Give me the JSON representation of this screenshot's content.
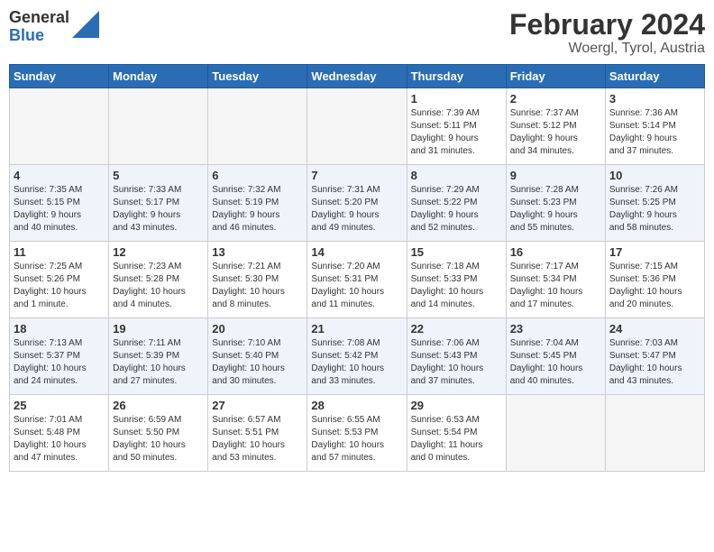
{
  "logo": {
    "general": "General",
    "blue": "Blue"
  },
  "header": {
    "title": "February 2024",
    "subtitle": "Woergl, Tyrol, Austria"
  },
  "weekdays": [
    "Sunday",
    "Monday",
    "Tuesday",
    "Wednesday",
    "Thursday",
    "Friday",
    "Saturday"
  ],
  "weeks": [
    [
      {
        "day": "",
        "info": ""
      },
      {
        "day": "",
        "info": ""
      },
      {
        "day": "",
        "info": ""
      },
      {
        "day": "",
        "info": ""
      },
      {
        "day": "1",
        "info": "Sunrise: 7:39 AM\nSunset: 5:11 PM\nDaylight: 9 hours\nand 31 minutes."
      },
      {
        "day": "2",
        "info": "Sunrise: 7:37 AM\nSunset: 5:12 PM\nDaylight: 9 hours\nand 34 minutes."
      },
      {
        "day": "3",
        "info": "Sunrise: 7:36 AM\nSunset: 5:14 PM\nDaylight: 9 hours\nand 37 minutes."
      }
    ],
    [
      {
        "day": "4",
        "info": "Sunrise: 7:35 AM\nSunset: 5:15 PM\nDaylight: 9 hours\nand 40 minutes."
      },
      {
        "day": "5",
        "info": "Sunrise: 7:33 AM\nSunset: 5:17 PM\nDaylight: 9 hours\nand 43 minutes."
      },
      {
        "day": "6",
        "info": "Sunrise: 7:32 AM\nSunset: 5:19 PM\nDaylight: 9 hours\nand 46 minutes."
      },
      {
        "day": "7",
        "info": "Sunrise: 7:31 AM\nSunset: 5:20 PM\nDaylight: 9 hours\nand 49 minutes."
      },
      {
        "day": "8",
        "info": "Sunrise: 7:29 AM\nSunset: 5:22 PM\nDaylight: 9 hours\nand 52 minutes."
      },
      {
        "day": "9",
        "info": "Sunrise: 7:28 AM\nSunset: 5:23 PM\nDaylight: 9 hours\nand 55 minutes."
      },
      {
        "day": "10",
        "info": "Sunrise: 7:26 AM\nSunset: 5:25 PM\nDaylight: 9 hours\nand 58 minutes."
      }
    ],
    [
      {
        "day": "11",
        "info": "Sunrise: 7:25 AM\nSunset: 5:26 PM\nDaylight: 10 hours\nand 1 minute."
      },
      {
        "day": "12",
        "info": "Sunrise: 7:23 AM\nSunset: 5:28 PM\nDaylight: 10 hours\nand 4 minutes."
      },
      {
        "day": "13",
        "info": "Sunrise: 7:21 AM\nSunset: 5:30 PM\nDaylight: 10 hours\nand 8 minutes."
      },
      {
        "day": "14",
        "info": "Sunrise: 7:20 AM\nSunset: 5:31 PM\nDaylight: 10 hours\nand 11 minutes."
      },
      {
        "day": "15",
        "info": "Sunrise: 7:18 AM\nSunset: 5:33 PM\nDaylight: 10 hours\nand 14 minutes."
      },
      {
        "day": "16",
        "info": "Sunrise: 7:17 AM\nSunset: 5:34 PM\nDaylight: 10 hours\nand 17 minutes."
      },
      {
        "day": "17",
        "info": "Sunrise: 7:15 AM\nSunset: 5:36 PM\nDaylight: 10 hours\nand 20 minutes."
      }
    ],
    [
      {
        "day": "18",
        "info": "Sunrise: 7:13 AM\nSunset: 5:37 PM\nDaylight: 10 hours\nand 24 minutes."
      },
      {
        "day": "19",
        "info": "Sunrise: 7:11 AM\nSunset: 5:39 PM\nDaylight: 10 hours\nand 27 minutes."
      },
      {
        "day": "20",
        "info": "Sunrise: 7:10 AM\nSunset: 5:40 PM\nDaylight: 10 hours\nand 30 minutes."
      },
      {
        "day": "21",
        "info": "Sunrise: 7:08 AM\nSunset: 5:42 PM\nDaylight: 10 hours\nand 33 minutes."
      },
      {
        "day": "22",
        "info": "Sunrise: 7:06 AM\nSunset: 5:43 PM\nDaylight: 10 hours\nand 37 minutes."
      },
      {
        "day": "23",
        "info": "Sunrise: 7:04 AM\nSunset: 5:45 PM\nDaylight: 10 hours\nand 40 minutes."
      },
      {
        "day": "24",
        "info": "Sunrise: 7:03 AM\nSunset: 5:47 PM\nDaylight: 10 hours\nand 43 minutes."
      }
    ],
    [
      {
        "day": "25",
        "info": "Sunrise: 7:01 AM\nSunset: 5:48 PM\nDaylight: 10 hours\nand 47 minutes."
      },
      {
        "day": "26",
        "info": "Sunrise: 6:59 AM\nSunset: 5:50 PM\nDaylight: 10 hours\nand 50 minutes."
      },
      {
        "day": "27",
        "info": "Sunrise: 6:57 AM\nSunset: 5:51 PM\nDaylight: 10 hours\nand 53 minutes."
      },
      {
        "day": "28",
        "info": "Sunrise: 6:55 AM\nSunset: 5:53 PM\nDaylight: 10 hours\nand 57 minutes."
      },
      {
        "day": "29",
        "info": "Sunrise: 6:53 AM\nSunset: 5:54 PM\nDaylight: 11 hours\nand 0 minutes."
      },
      {
        "day": "",
        "info": ""
      },
      {
        "day": "",
        "info": ""
      }
    ]
  ]
}
